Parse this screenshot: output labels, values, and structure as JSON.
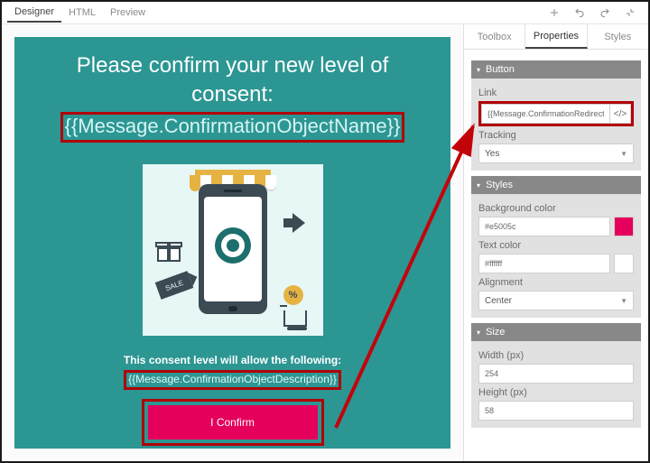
{
  "tabs": {
    "designer": "Designer",
    "html": "HTML",
    "preview": "Preview"
  },
  "canvas": {
    "title_line1": "Please confirm your new level of",
    "title_line2": "consent:",
    "merge_name": "{{Message.ConfirmationObjectName}}",
    "subtext": "This consent level will allow the following:",
    "merge_desc": "{{Message.ConfirmationObjectDescription}}",
    "confirm_label": "I Confirm",
    "sale_tag": "SALE",
    "pct": "%"
  },
  "side": {
    "tabs": {
      "toolbox": "Toolbox",
      "properties": "Properties",
      "styles": "Styles"
    },
    "button": {
      "header": "Button",
      "link_label": "Link",
      "link_value": "{{Message.ConfirmationRedirectURL}}",
      "code_btn": "</>",
      "tracking_label": "Tracking",
      "tracking_value": "Yes"
    },
    "styles": {
      "header": "Styles",
      "bg_label": "Background color",
      "bg_value": "#e5005c",
      "text_label": "Text color",
      "text_value": "#ffffff",
      "align_label": "Alignment",
      "align_value": "Center"
    },
    "size": {
      "header": "Size",
      "width_label": "Width (px)",
      "width_value": "254",
      "height_label": "Height (px)",
      "height_value": "58"
    }
  }
}
